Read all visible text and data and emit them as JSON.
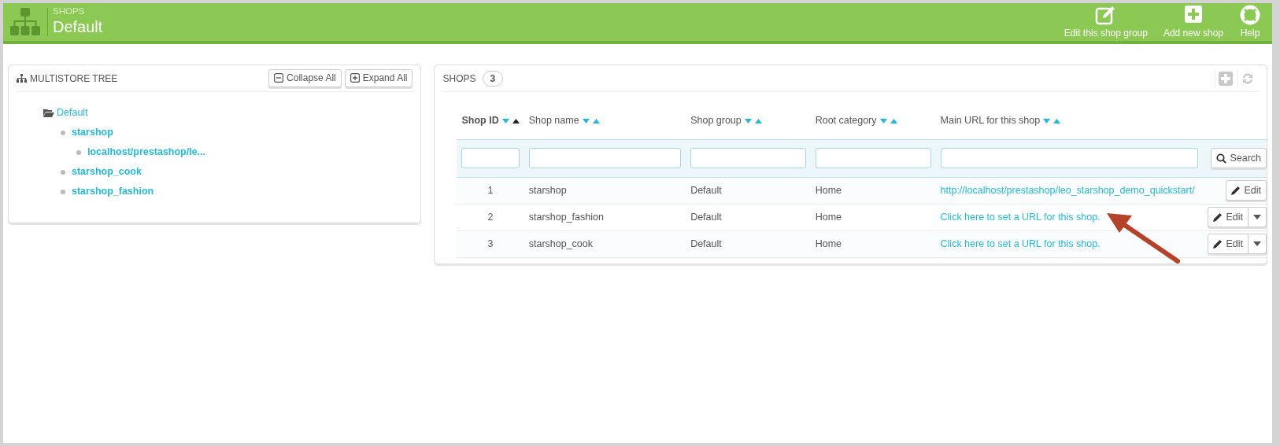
{
  "header": {
    "breadcrumb": "SHOPS",
    "title": "Default",
    "toolbar": [
      {
        "kind": "edit",
        "label": "Edit this shop group"
      },
      {
        "kind": "add",
        "label": "Add new shop"
      },
      {
        "kind": "help",
        "label": "Help"
      }
    ]
  },
  "tree_panel": {
    "title": "MULTISTORE TREE",
    "buttons": [
      {
        "kind": "collapse",
        "label": "Collapse All"
      },
      {
        "kind": "expand",
        "label": "Expand All"
      }
    ],
    "tree": [
      {
        "label": "Default",
        "expanded": true,
        "children": [
          {
            "label": "starshop",
            "children": [
              {
                "label": "localhost/prestashop/le..."
              }
            ]
          },
          {
            "label": "starshop_cook"
          },
          {
            "label": "starshop_fashion"
          }
        ]
      }
    ]
  },
  "shops_panel": {
    "title": "SHOPS",
    "count": "3",
    "table": {
      "columns": [
        {
          "label": "Shop ID",
          "sorted_ascending": true
        },
        {
          "label": "Shop name",
          "sorted_ascending": false
        },
        {
          "label": "Shop group",
          "sorted_ascending": false
        },
        {
          "label": "Root category",
          "sorted_ascending": false
        },
        {
          "label": "Main URL for this shop",
          "sorted_ascending": false
        }
      ],
      "filter_button": "Search",
      "rows": [
        {
          "cells": [
            "1",
            "starshop",
            "Default",
            "Home"
          ],
          "url": "http://localhost/prestashop/leo_starshop_demo_quickstart/",
          "edit": "Edit",
          "dropdown": false
        },
        {
          "cells": [
            "2",
            "starshop_fashion",
            "Default",
            "Home"
          ],
          "url": "Click here to set a URL for this shop.",
          "edit": "Edit",
          "dropdown": true
        },
        {
          "cells": [
            "3",
            "starshop_cook",
            "Default",
            "Home"
          ],
          "url": "Click here to set a URL for this shop.",
          "edit": "Edit",
          "dropdown": true
        }
      ]
    }
  }
}
